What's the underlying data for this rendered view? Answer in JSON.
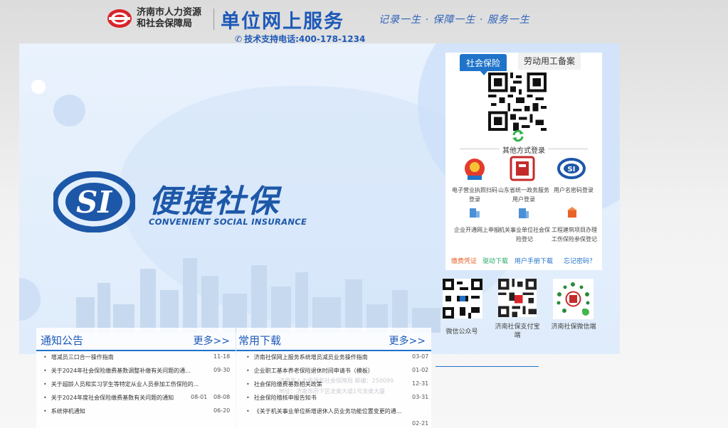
{
  "header": {
    "org_line1": "济南市人力资源",
    "org_line2": "和社会保障局",
    "brand": "单位网上服务",
    "slogan": "记录一生 · 保障一生 · 服务一生",
    "hotline": "技术支持电话:400-178-1234"
  },
  "banner": {
    "title": "便捷社保",
    "subtitle": "CONVENIENT SOCIAL INSURANCE"
  },
  "login": {
    "tab_active": "社会保险",
    "tab_other": "劳动用工备案",
    "other_methods": "其他方式登录",
    "methods": [
      {
        "label": "电子营业执照扫码登录",
        "icon": "business-license-icon"
      },
      {
        "label": "山东省统一政务服务用户登录",
        "icon": "gov-service-icon"
      },
      {
        "label": "用户名密码登录",
        "icon": "password-login-icon"
      },
      {
        "label": "企业开通网上申报",
        "icon": "enterprise-icon"
      },
      {
        "label": "机关事业单位社会保险登记",
        "icon": "institution-icon"
      },
      {
        "label": "工程建筑项目办理工伤保险参保登记",
        "icon": "construction-icon"
      }
    ],
    "links": [
      "缴费凭证",
      "驱动下载",
      "用户手册下载",
      "忘记密码？"
    ],
    "link_colors": [
      "#e8632a",
      "#2aa86a",
      "#1f73c9",
      "#1f73c9"
    ]
  },
  "qr_codes": [
    {
      "label": "微信公众号"
    },
    {
      "label": "济南社保支付宝端"
    },
    {
      "label": "济南社保微信端"
    }
  ],
  "notices": {
    "title": "通知公告",
    "more": "更多>>",
    "items": [
      {
        "text": "增减员三口合一操作指南",
        "date": "11-18"
      },
      {
        "text": "关于2024年社会保险缴费基数调整补缴有关问题的通...",
        "date": "09-30"
      },
      {
        "text": "关于超龄人员和实习学生等特定从业人员参加工伤保险的...",
        "date": ""
      },
      {
        "text": "关于2024年度社会保险缴费基数有关问题的通知",
        "date": "08-01"
      },
      {
        "text": "系统停机通知",
        "date": "06-20"
      }
    ],
    "extra_date": "08-08"
  },
  "downloads": {
    "title": "常用下载",
    "more": "更多>>",
    "items": [
      {
        "text": "济南社保网上服务系统增员减员业务操作指南",
        "date": "03-07"
      },
      {
        "text": "企业职工基本养老保险退休时间申请书（模板）",
        "date": "01-02"
      },
      {
        "text": "社会保险缴费基数相关政策",
        "date": "12-31"
      },
      {
        "text": "社会保险稽核申报告知书",
        "date": "03-31"
      },
      {
        "text": "《关于机关事业单位新增退休人员业务功能位置变更的通...",
        "date": "02-21"
      }
    ]
  },
  "footer_ghost": {
    "line1": "济南市人力资源和社会保障局   邮编：250099",
    "line2": "地址：济南市历下区龙奥大道1号龙奥大厦"
  }
}
